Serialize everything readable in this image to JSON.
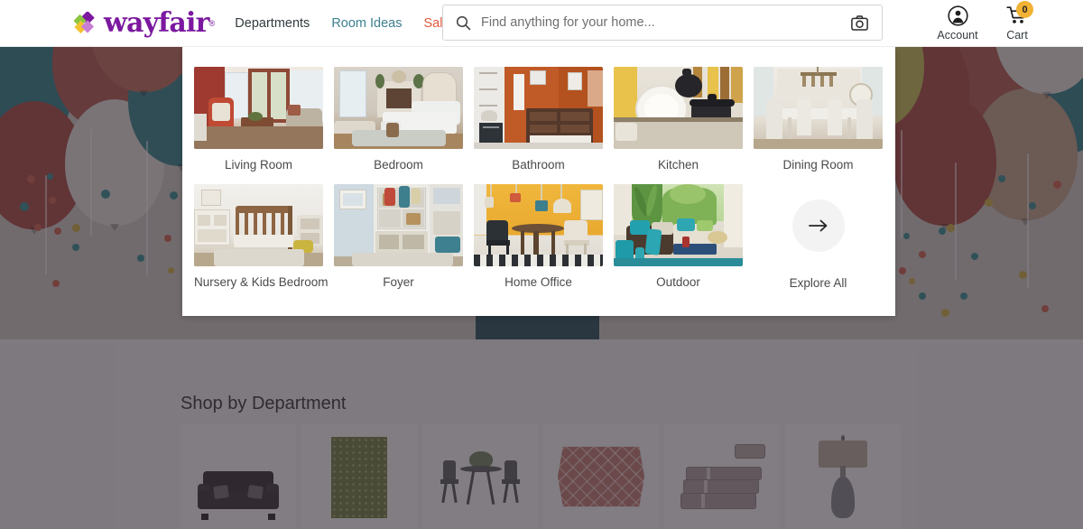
{
  "header": {
    "logo": {
      "text": "wayfair",
      "registered": "®",
      "icon": "wayfair-diamond-logo"
    },
    "nav": [
      {
        "label": "Departments",
        "style": "dark"
      },
      {
        "label": "Room Ideas",
        "style": "teal"
      },
      {
        "label": "Sale",
        "style": "sale"
      }
    ],
    "search": {
      "placeholder": "Find anything for your home...",
      "value": "",
      "search_icon": "search-icon",
      "camera_icon": "camera-icon"
    },
    "account": {
      "label": "Account",
      "icon": "account-person-icon"
    },
    "cart": {
      "label": "Cart",
      "icon": "shopping-cart-icon",
      "badge_count": "0",
      "badge_color": "#f2b234"
    }
  },
  "dropdown": {
    "items": [
      {
        "label": "Living Room"
      },
      {
        "label": "Bedroom"
      },
      {
        "label": "Bathroom"
      },
      {
        "label": "Kitchen"
      },
      {
        "label": "Dining Room"
      },
      {
        "label": "Nursery & Kids Bedroom"
      },
      {
        "label": "Foyer"
      },
      {
        "label": "Home Office"
      },
      {
        "label": "Outdoor"
      }
    ],
    "explore": {
      "label": "Explore All",
      "icon": "arrow-right-icon",
      "glyph": "→"
    }
  },
  "hero": {
    "carousel_dots": [
      {
        "active": true
      },
      {
        "active": false
      },
      {
        "active": false
      }
    ],
    "cta_color": "#1e4953"
  },
  "lower": {
    "title": "Shop by Department",
    "products": [
      {
        "name": "sofa"
      },
      {
        "name": "area-rug"
      },
      {
        "name": "bistro-set"
      },
      {
        "name": "throw-pillow"
      },
      {
        "name": "towel-set"
      },
      {
        "name": "table-lamp"
      }
    ]
  },
  "colors": {
    "brand_purple": "#7b189f",
    "teal_link": "#3c7f8e",
    "sale_red": "#e2583c",
    "overlay": "#625c63",
    "badge": "#f2b234"
  }
}
